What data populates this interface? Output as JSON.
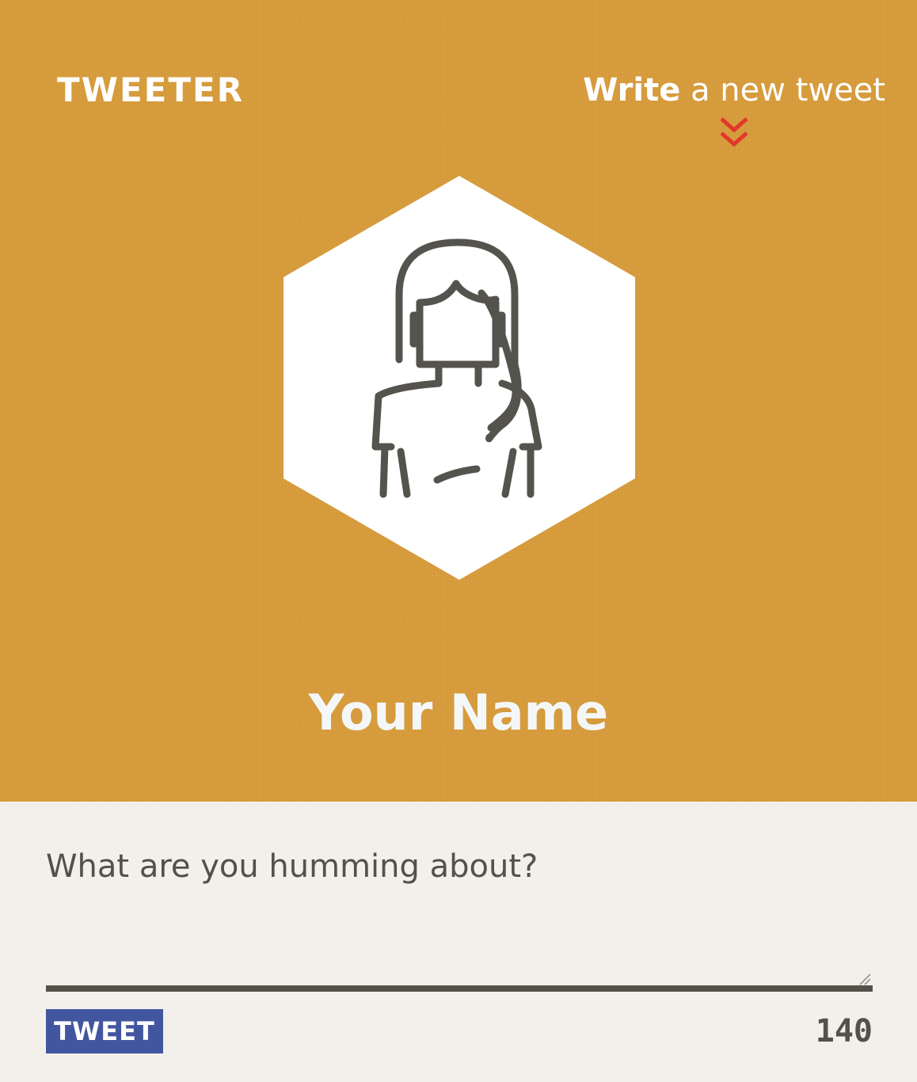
{
  "header": {
    "logo": "TWEETER",
    "compose_toggle": {
      "strong": "Write",
      "rest": " a new tweet",
      "icon": "double-chevron-down-icon",
      "icon_color": "#e2382b"
    },
    "avatar_icon": "woman-avatar-icon",
    "user_name": "Your Name",
    "background_color": "#d79c3c"
  },
  "composer": {
    "placeholder": "What are you humming about?",
    "value": "",
    "tweet_button_label": "TWEET",
    "tweet_button_color": "#4256a0",
    "char_counter": "140",
    "text_color": "#545149"
  }
}
